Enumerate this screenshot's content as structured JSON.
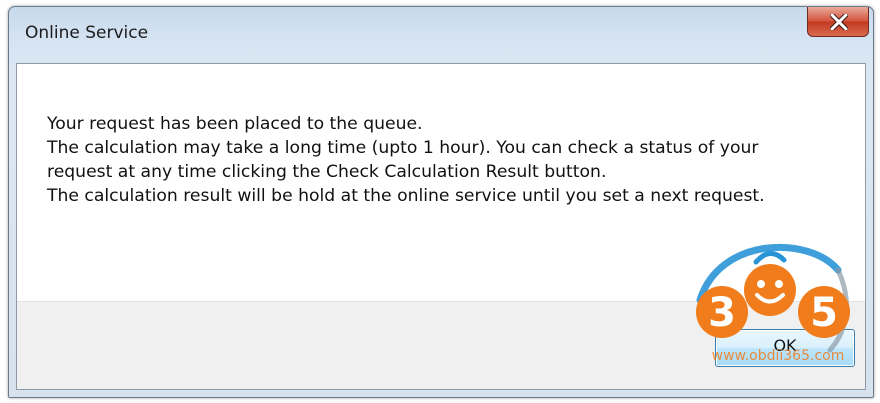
{
  "window": {
    "title": "Online Service"
  },
  "message": {
    "lines": [
      "Your request has been placed to the queue.",
      "The calculation may take a long time (upto 1 hour). You can check a status of your request at any time clicking the Check Calculation Result button.",
      "The calculation result will be hold at the online service until you set a next request."
    ]
  },
  "buttons": {
    "ok_label": "OK"
  },
  "watermark": {
    "digit_left": "3",
    "digit_right": "5",
    "url": "www.obdii365.com"
  },
  "colors": {
    "close_button": "#c23a20",
    "watermark_orange": "#f07c1c",
    "watermark_blue": "#2a95d6"
  },
  "icons": {
    "close": "close-icon"
  }
}
